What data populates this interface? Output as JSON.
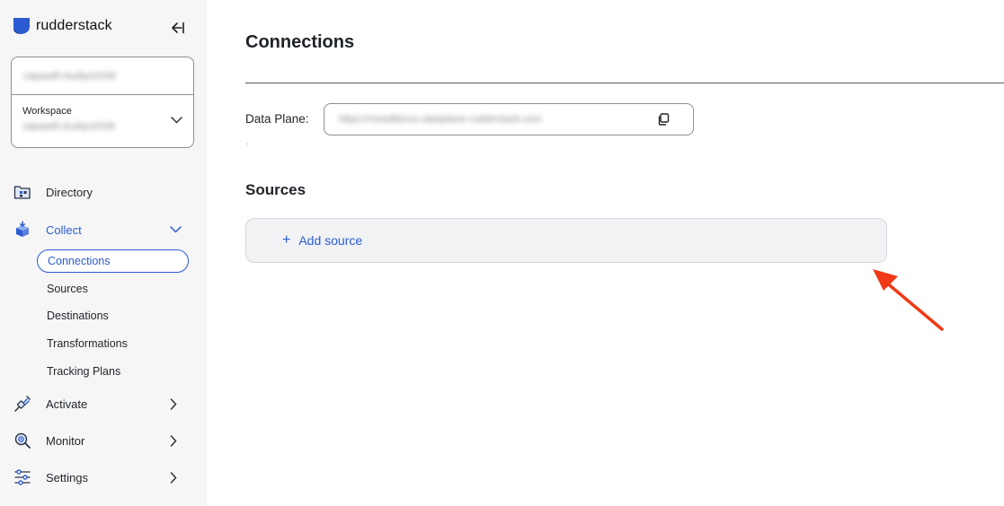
{
  "brand": {
    "name": "rudderstack"
  },
  "workspace": {
    "org_value": "zapaadh-budiyo2038",
    "label": "Workspace",
    "value": "zapaadh-budiyo2038"
  },
  "nav": {
    "directory": "Directory",
    "collect": "Collect",
    "collect_sub": {
      "connections": "Connections",
      "sources": "Sources",
      "destinations": "Destinations",
      "transformations": "Transformations",
      "tracking_plans": "Tracking Plans"
    },
    "activate": "Activate",
    "monitor": "Monitor",
    "settings": "Settings"
  },
  "main": {
    "title": "Connections",
    "data_plane_label": "Data Plane:",
    "data_plane_value": "https://rosedbknox.dataplane.rudderstack.com",
    "dot": ".",
    "sources_title": "Sources",
    "add_source_label": "Add source",
    "add_source_plus": "+"
  },
  "colors": {
    "accent": "#2d5bd1",
    "sidebar_bg": "#f6f6f7",
    "annotation_arrow": "#f03a17"
  }
}
